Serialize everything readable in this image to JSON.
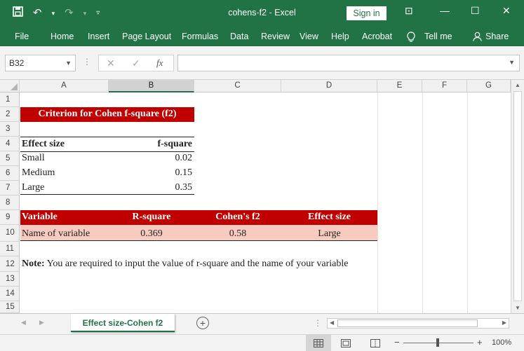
{
  "titlebar": {
    "title": "cohens-f2  -  Excel",
    "signin_label": "Sign in",
    "save_icon": "save-icon",
    "undo_icon": "undo-icon",
    "redo_icon": "redo-icon"
  },
  "ribbon": {
    "tabs": [
      "File",
      "Home",
      "Insert",
      "Page Layout",
      "Formulas",
      "Data",
      "Review",
      "View",
      "Help",
      "Acrobat",
      "Tell me",
      "Share"
    ]
  },
  "formula_bar": {
    "name_box": "B32",
    "fx": "fx",
    "formula": ""
  },
  "columns": [
    "A",
    "B",
    "C",
    "D",
    "E",
    "F",
    "G"
  ],
  "rows": [
    "1",
    "2",
    "3",
    "4",
    "5",
    "6",
    "7",
    "8",
    "9",
    "10",
    "11",
    "12",
    "13",
    "14",
    "15"
  ],
  "criterion": {
    "title": "Criterion for Cohen f-square (f2)",
    "header": {
      "effect_size": "Effect size",
      "f_square": "f-square"
    },
    "rows": [
      {
        "effect_size": "Small",
        "f_square": "0.02"
      },
      {
        "effect_size": "Medium",
        "f_square": "0.15"
      },
      {
        "effect_size": "Large",
        "f_square": "0.35"
      }
    ]
  },
  "result": {
    "headers": [
      "Variable",
      "R-square",
      "Cohen's f2",
      "Effect size"
    ],
    "row": [
      "Name of variable",
      "0.369",
      "0.58",
      "Large"
    ]
  },
  "note": {
    "label": "Note:",
    "text": "You are required to input the value of r-square and the name of your variable"
  },
  "sheet_tab": "Effect size-Cohen f2",
  "status": {
    "zoom": "100%"
  },
  "colors": {
    "excel_green": "#217346",
    "header_red": "#c00000",
    "row_pink": "#f8cbc0"
  }
}
